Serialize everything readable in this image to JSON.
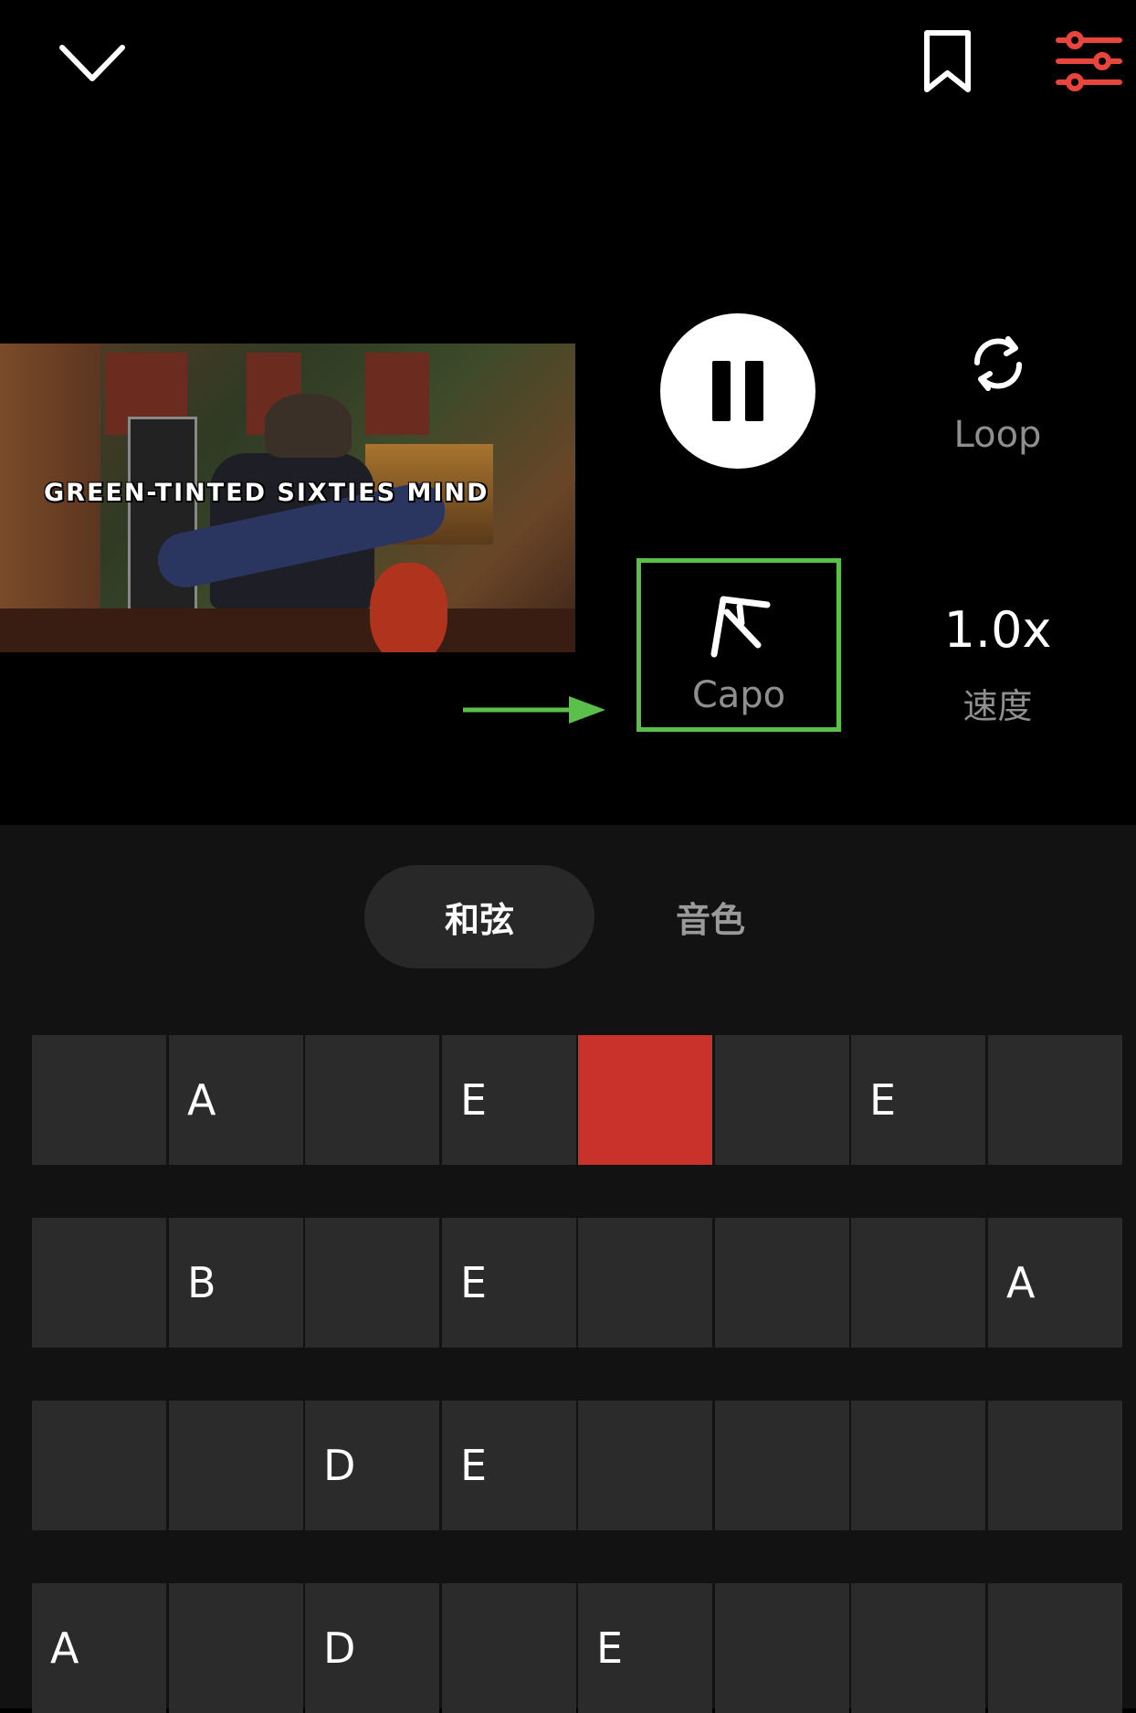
{
  "topbar": {
    "collapse_icon": "chevron-down-icon",
    "bookmark_icon": "bookmark-icon",
    "settings_icon": "sliders-icon",
    "settings_color": "#e8453c"
  },
  "video": {
    "caption": "GREEN-TINTED SIXTIES MIND"
  },
  "controls": {
    "pause_icon": "pause-icon",
    "loop_label": "Loop",
    "capo_label": "Capo",
    "speed_value": "1.0x",
    "speed_label": "速度",
    "highlight_color": "#5bc049"
  },
  "tabs": {
    "chords": "和弦",
    "tone": "音色"
  },
  "chord_grid": {
    "active_color": "#c8322b",
    "rows": [
      [
        "",
        "A",
        "",
        "E",
        "",
        "",
        "E",
        ""
      ],
      [
        "",
        "B",
        "",
        "E",
        "",
        "",
        "",
        "A"
      ],
      [
        "",
        "",
        "D",
        "E",
        "",
        "",
        "",
        ""
      ],
      [
        "A",
        "",
        "D",
        "",
        "E",
        "",
        "",
        ""
      ]
    ],
    "active_cell": {
      "row": 0,
      "col": 4
    }
  }
}
